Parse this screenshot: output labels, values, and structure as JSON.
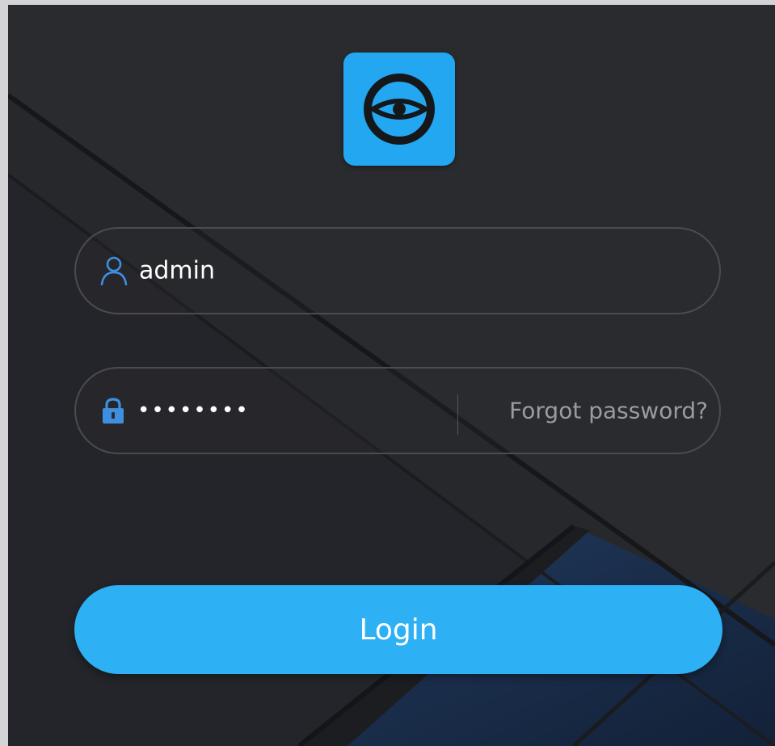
{
  "login": {
    "username_value": "admin",
    "password_value": "••••••••",
    "forgot_label": "Forgot password?",
    "login_label": "Login"
  },
  "icons": {
    "logo": "eye-logo-icon",
    "username": "user-icon",
    "password": "lock-icon"
  },
  "colors": {
    "accent": "#2db1f4",
    "logo_bg": "#22a7f0",
    "background": "#2a2b2f",
    "field_border": "#4a4c52",
    "muted_text": "#9a9ca3",
    "icon_blue": "#3d8fe0"
  }
}
